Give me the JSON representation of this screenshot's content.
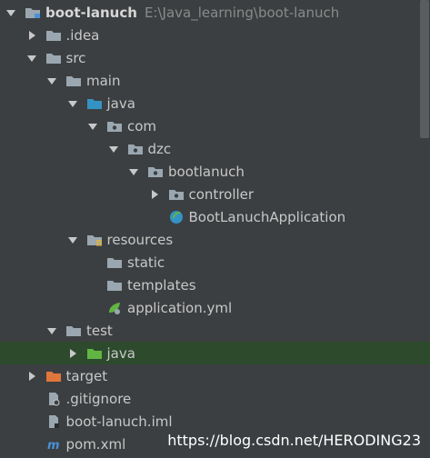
{
  "tree": [
    {
      "label": "boot-lanuch",
      "path": "E:\\Java_learning\\boot-lanuch",
      "bold": true,
      "depth": 0,
      "arrow": "down",
      "icon": "module-folder"
    },
    {
      "label": ".idea",
      "depth": 1,
      "arrow": "right",
      "icon": "folder"
    },
    {
      "label": "src",
      "depth": 1,
      "arrow": "down",
      "icon": "folder"
    },
    {
      "label": "main",
      "depth": 2,
      "arrow": "down",
      "icon": "folder"
    },
    {
      "label": "java",
      "depth": 3,
      "arrow": "down",
      "icon": "source-folder"
    },
    {
      "label": "com",
      "depth": 4,
      "arrow": "down",
      "icon": "package"
    },
    {
      "label": "dzc",
      "depth": 5,
      "arrow": "down",
      "icon": "package"
    },
    {
      "label": "bootlanuch",
      "depth": 6,
      "arrow": "down",
      "icon": "package"
    },
    {
      "label": "controller",
      "depth": 7,
      "arrow": "right",
      "icon": "package"
    },
    {
      "label": "BootLanuchApplication",
      "depth": 7,
      "arrow": "none",
      "icon": "spring-boot-class"
    },
    {
      "label": "resources",
      "depth": 3,
      "arrow": "down",
      "icon": "resources-folder"
    },
    {
      "label": "static",
      "depth": 4,
      "arrow": "none",
      "icon": "folder"
    },
    {
      "label": "templates",
      "depth": 4,
      "arrow": "none",
      "icon": "folder"
    },
    {
      "label": "application.yml",
      "depth": 4,
      "arrow": "none",
      "icon": "spring-config-file"
    },
    {
      "label": "test",
      "depth": 2,
      "arrow": "down",
      "icon": "folder"
    },
    {
      "label": "java",
      "depth": 3,
      "arrow": "right",
      "icon": "test-source-folder",
      "selected": true
    },
    {
      "label": "target",
      "depth": 1,
      "arrow": "right",
      "icon": "excluded-folder"
    },
    {
      "label": ".gitignore",
      "depth": 1,
      "arrow": "none",
      "icon": "ignore-file"
    },
    {
      "label": "boot-lanuch.iml",
      "depth": 1,
      "arrow": "none",
      "icon": "iml-file"
    },
    {
      "label": "pom.xml",
      "depth": 1,
      "arrow": "none",
      "icon": "maven-file"
    }
  ],
  "watermark": "https://blog.csdn.net/HERODING23"
}
